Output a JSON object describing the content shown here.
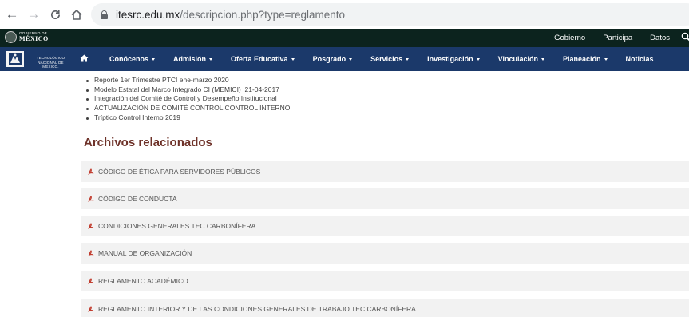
{
  "browser": {
    "url_domain": "itesrc.edu.mx",
    "url_path": "/descripcion.php?type=reglamento"
  },
  "gov_bar": {
    "logo_small": "GOBIERNO DE",
    "logo_big": "MÉXICO",
    "links": [
      "Gobierno",
      "Participa",
      "Datos"
    ]
  },
  "tec_bar": {
    "logo_line1": "TECNOLÓGICO",
    "logo_line2": "NACIONAL DE MÉXICO.",
    "menu": [
      {
        "label": "Conócenos",
        "dropdown": true
      },
      {
        "label": "Admisión",
        "dropdown": true
      },
      {
        "label": "Oferta Educativa",
        "dropdown": true
      },
      {
        "label": "Posgrado",
        "dropdown": true
      },
      {
        "label": "Servicios",
        "dropdown": true
      },
      {
        "label": "Investigación",
        "dropdown": true
      },
      {
        "label": "Vinculación",
        "dropdown": true
      },
      {
        "label": "Planeación",
        "dropdown": true
      },
      {
        "label": "Noticias",
        "dropdown": false
      }
    ]
  },
  "content": {
    "bullets": [
      "Reporte 1er Trimestre PTCI ene-marzo 2020",
      "Modelo Estatal del Marco Integrado CI (MEMICI)_21-04-2017",
      "Integración del Comité de Control y Desempeño Institucional",
      "ACTUALIZACIÓN DE COMITÉ CONTROL CONTROL INTERNO",
      "Tríptico Control Interno 2019"
    ],
    "section_title": "Archivos relacionados",
    "files": [
      "CÓDIGO DE ÉTICA PARA SERVIDORES PÚBLICOS",
      "CÓDIGO DE CONDUCTA",
      "CONDICIONES GENERALES TEC CARBONÍFERA",
      "MANUAL DE ORGANIZACIÓN",
      "REGLAMENTO ACADÉMICO",
      "REGLAMENTO INTERIOR Y DE LAS CONDICIONES GENERALES DE TRABAJO TEC CARBONÍFERA"
    ]
  },
  "colors": {
    "gov_bar": "#0c231e",
    "tec_bar": "#1b396a",
    "section_title": "#6e3229",
    "pdf_icon": "#c0392b",
    "file_row_bg": "#f2f2f2"
  }
}
